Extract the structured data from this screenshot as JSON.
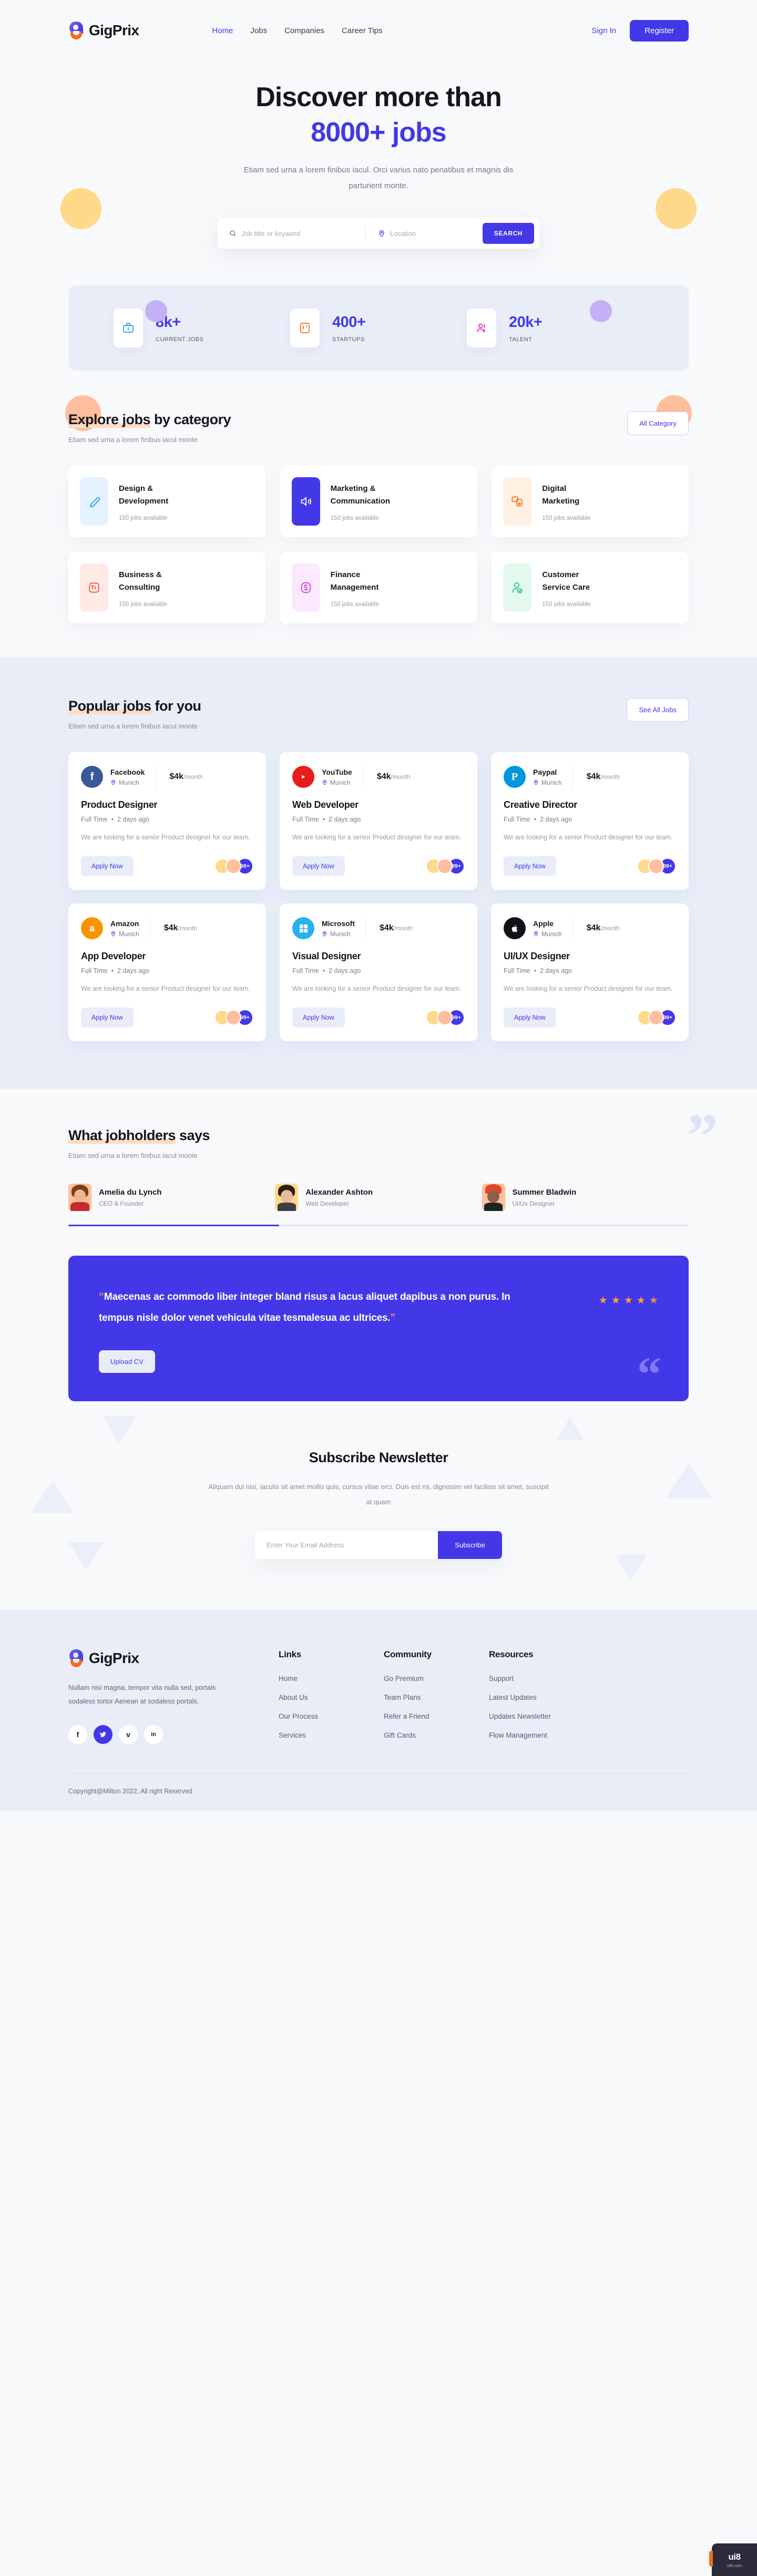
{
  "brand": {
    "name": "GigPrix",
    "logo_icon": "gigprix-g-logo"
  },
  "nav": {
    "links": [
      {
        "label": "Home",
        "active": true
      },
      {
        "label": "Jobs",
        "active": false
      },
      {
        "label": "Companies",
        "active": false
      },
      {
        "label": "Career Tips",
        "active": false
      }
    ],
    "signin_label": "Sign In",
    "register_label": "Register"
  },
  "hero": {
    "title_line1": "Discover more than",
    "title_line2": "8000+ jobs",
    "subtitle": "Etiam sed urna a lorem finibus iacul. Orci varius nato penatibus et magnis dis parturient monte.",
    "search": {
      "keyword_placeholder": "Job title or keyword",
      "keyword_value": "",
      "location_placeholder": "Location",
      "location_value": "",
      "button_label": "SEARCH",
      "search_icon": "magnifier-icon",
      "location_icon": "map-pin-icon"
    }
  },
  "stats": [
    {
      "value": "8k+",
      "label": "CURRENT JOBS",
      "icon": "briefcase-icon",
      "color": "#2196f3"
    },
    {
      "value": "400+",
      "label": "STARTUPS",
      "icon": "kanban-board-icon",
      "color": "#fa6a1b"
    },
    {
      "value": "20k+",
      "label": "TALENT",
      "icon": "people-icon",
      "color": "#e321c6"
    }
  ],
  "categories_section": {
    "title_highlight": "Explore jobs",
    "title_rest": " by category",
    "subtitle": "Etiam sed urna a lorem finibus iacul monte",
    "button_label": "All Category",
    "items": [
      {
        "name": "Design &\nDevelopment",
        "jobs": "150 jobs available",
        "icon": "pen-design-icon",
        "bg": "#e4f3ff",
        "fg": "#2196f3",
        "active": false
      },
      {
        "name": "Marketing &\nCommunication",
        "jobs": "150 jobs available",
        "icon": "speaker-icon",
        "bg": "#4338e8",
        "fg": "#ffffff",
        "active": true
      },
      {
        "name": "Digital\nMarketing",
        "jobs": "150 jobs available",
        "icon": "digital-device-icon",
        "bg": "#fff0e4",
        "fg": "#fa6a1b",
        "active": false
      },
      {
        "name": "Business &\nConsulting",
        "jobs": "150 jobs available",
        "icon": "chart-bar-icon",
        "bg": "#ffeae6",
        "fg": "#f4502c",
        "active": false
      },
      {
        "name": "Finance\nManagement",
        "jobs": "150 jobs available",
        "icon": "dollar-icon",
        "bg": "#fbeaff",
        "fg": "#d133e3",
        "active": false
      },
      {
        "name": "Customer\nService Care",
        "jobs": "150 jobs available",
        "icon": "customer-care-icon",
        "bg": "#e4f8ee",
        "fg": "#23c37e",
        "active": false
      }
    ]
  },
  "jobs_section": {
    "title_highlight": "Popular jobs",
    "title_rest": " for you",
    "subtitle": "Etiam sed urna a lorem finibus iacul monte",
    "button_label": "See All Jobs",
    "apply_label": "Apply Now",
    "applicants_badge": "99+",
    "items": [
      {
        "company": "Facebook",
        "location": "Munich",
        "pay": "$4k",
        "pay_unit": "/month",
        "title": "Product Designer",
        "type": "Full Time",
        "posted": "2 days ago",
        "desc": "We are looking for a senior Product designer for our team.",
        "logo_icon": "facebook-icon",
        "logo_bg": "#3b5998"
      },
      {
        "company": "YouTube",
        "location": "Munich",
        "pay": "$4k",
        "pay_unit": "/month",
        "title": "Web Developer",
        "type": "Full Time",
        "posted": "2 days ago",
        "desc": "We are looking for a senior Product designer for our team.",
        "logo_icon": "youtube-icon",
        "logo_bg": "#e51d1d"
      },
      {
        "company": "Paypal",
        "location": "Munich",
        "pay": "$4k",
        "pay_unit": "/month",
        "title": "Creative Director",
        "type": "Full Time",
        "posted": "2 days ago",
        "desc": "We are looking for a senior Product designer for our team.",
        "logo_icon": "paypal-icon",
        "logo_bg": "#0097e0"
      },
      {
        "company": "Amazon",
        "location": "Munich",
        "pay": "$4k",
        "pay_unit": "/month",
        "title": "App Developer",
        "type": "Full Time",
        "posted": "2 days ago",
        "desc": "We are looking for a senior Product designer for our team.",
        "logo_icon": "amazon-icon",
        "logo_bg": "#f79400"
      },
      {
        "company": "Microsoft",
        "location": "Munich",
        "pay": "$4k",
        "pay_unit": "/month",
        "title": "Visual Designer",
        "type": "Full Time",
        "posted": "2 days ago",
        "desc": "We are looking for a senior Product designer for our team.",
        "logo_icon": "microsoft-icon",
        "logo_bg": "#29b0ef"
      },
      {
        "company": "Apple",
        "location": "Munich",
        "pay": "$4k",
        "pay_unit": "/month",
        "title": "UI/UX Designer",
        "type": "Full Time",
        "posted": "2 days ago",
        "desc": "We are looking for a senior Product designer for our team.",
        "logo_icon": "apple-icon",
        "logo_bg": "#111118"
      }
    ]
  },
  "testimonials_section": {
    "title_highlight": "What jobholders",
    "title_rest": " says",
    "subtitle": "Etiam sed urna a lorem finibus iacul monte",
    "people": [
      {
        "name": "Amelia du Lynch",
        "role": "CEO & Founder",
        "avatar_bg": "#ffbe9d",
        "active": true
      },
      {
        "name": "Alexander Ashton",
        "role": "Web Developer",
        "avatar_bg": "#ffd98a",
        "active": false
      },
      {
        "name": "Summer Bladwin",
        "role": "Ui/Ux Designer",
        "avatar_bg": "#ffbe9d",
        "active": false
      }
    ],
    "quote": "Maecenas ac commodo liber integer bland risus a lacus aliquet dapibus a non purus. In tempus nisle dolor venet vehicula vitae tesmalesua ac ultrices.",
    "rating": 4.5,
    "stars_total": 5,
    "upload_label": "Upload CV",
    "quote_open": "“",
    "quote_close": "”"
  },
  "newsletter": {
    "title": "Subscribe Newsletter",
    "subtitle": "Aliquam dui nisi, iaculis sit amet mollis quis, cursus vitae orci. Duis est mi, dignissim vel facilisis sit amet, suscipit at quam",
    "email_placeholder": "Enter Your Email Address",
    "email_value": "",
    "button_label": "Subscribe"
  },
  "footer": {
    "about_text": "Nullam nisi magna, tempor vita nulla sed, portals sodaless tortor Aenean at sodaless portals.",
    "socials": [
      {
        "icon": "facebook-icon",
        "glyph": "f",
        "active": false
      },
      {
        "icon": "twitter-icon",
        "glyph": "❦",
        "active": true
      },
      {
        "icon": "vimeo-icon",
        "glyph": "v",
        "active": false
      },
      {
        "icon": "linkedin-icon",
        "glyph": "in",
        "active": false
      }
    ],
    "columns": [
      {
        "heading": "Links",
        "links": [
          "Home",
          "About Us",
          "Our Process",
          "Services"
        ]
      },
      {
        "heading": "Community",
        "links": [
          "Go Premium",
          "Team Plans",
          "Refer a Friend",
          "Gift Cards"
        ]
      },
      {
        "heading": "Resources",
        "links": [
          "Support",
          "Latest Updates",
          "Updates Newsletter",
          "Flow Management"
        ]
      }
    ],
    "copyright": "Copyright@Milton 2022, All right Reserved"
  },
  "watermark": {
    "line1": "ui8",
    "line2": "ui8.com"
  },
  "colors": {
    "accent": "#4338e8",
    "orange": "#fa6a1b",
    "highlight": "#ffdcc2",
    "page_bg": "#f8f9fb",
    "band_bg": "#e8edf8",
    "star": "#ffa32e"
  }
}
